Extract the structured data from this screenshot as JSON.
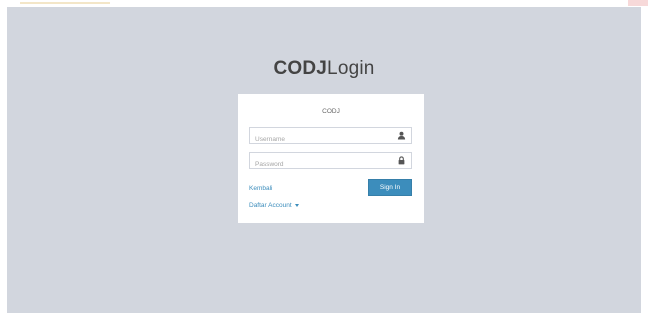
{
  "logo": {
    "bold": "CODJ",
    "light": "Login"
  },
  "login_box": {
    "message": "CODJ",
    "username": {
      "placeholder": "Username",
      "value": "",
      "icon": "user-icon"
    },
    "password": {
      "placeholder": "Password",
      "value": "",
      "icon": "lock-icon"
    },
    "signin_label": "Sign In",
    "back_link": "Kembali",
    "register_link": "Daftar Account",
    "register_icon": "caret-down-icon"
  },
  "colors": {
    "background": "#d2d6de",
    "box": "#ffffff",
    "accent": "#3c8dbc",
    "text": "#444444"
  }
}
